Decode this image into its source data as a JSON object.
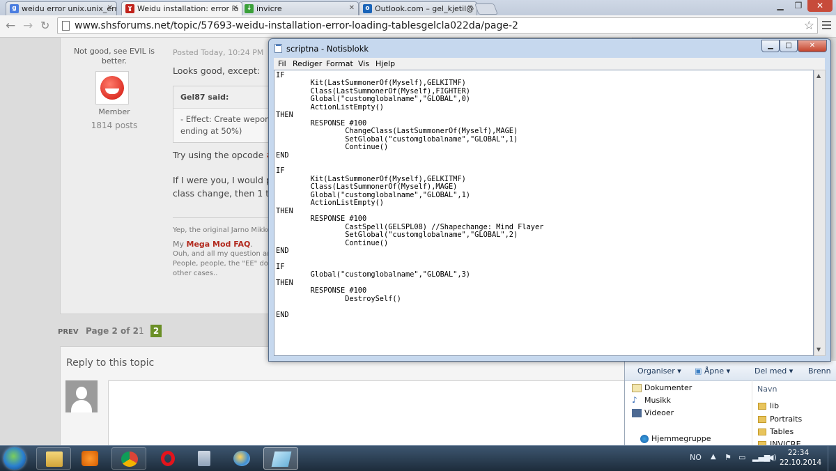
{
  "browser": {
    "tabs": [
      {
        "title": "weidu error unix.unix_erro",
        "icon": "google-icon",
        "color": "#4a7de0",
        "active": false
      },
      {
        "title": "Weidu installation: error lo",
        "icon": "shs-devil-icon",
        "color": "#c0231c",
        "active": true
      },
      {
        "title": "invicre",
        "icon": "download-icon",
        "color": "#3aa03a",
        "active": false
      },
      {
        "title": "Outlook.com – gel_kjetil@",
        "icon": "outlook-icon",
        "color": "#1a64b8",
        "active": false
      }
    ],
    "url": "www.shsforums.net/topic/57693-weidu-installation-error-loading-tablesgelcla022da/page-2"
  },
  "post": {
    "user_rank": "Not good, see EVIL is better.",
    "member_group": "Member",
    "post_count": "1814 posts",
    "posted": "Posted Today, 10:24 PM",
    "line1": "Looks good, except:",
    "quote_author": "Gel87 said:",
    "quote_line1": "- Effect: Create wepon(",
    "quote_line2": "ending at 50%)",
    "try_prefix": "Try using the opcode ",
    "try_opcode": "#",
    "line3a": "If I were you, I would pl",
    "line3b": "class change, then 1 to",
    "sig_line1": "Yep, the original Jarno Mikko",
    "sig_my": "My ",
    "sig_link": "Mega Mod FAQ",
    "sig_dot": ".",
    "sig_line3": "Ouh, and all my question ans",
    "sig_line4": "People, people, the \"EE\" does",
    "sig_line5": "other cases.."
  },
  "pagination": {
    "prev": "PREV",
    "label": "Page 2 of 2",
    "page1": "1",
    "page2": "2"
  },
  "reply": {
    "title": "Reply to this topic"
  },
  "notepad": {
    "title": "scriptna - Notisblokk",
    "menu": [
      "Fil",
      "Rediger",
      "Format",
      "Vis",
      "Hjelp"
    ],
    "code": "IF\n\tKit(LastSummonerOf(Myself),GELKITMF)\n\tClass(LastSummonerOf(Myself),FIGHTER)\n\tGlobal(\"customglobalname\",\"GLOBAL\",0)\n\tActionListEmpty()\nTHEN\n\tRESPONSE #100\n\t\tChangeClass(LastSummonerOf(Myself),MAGE)\n\t\tSetGlobal(\"customglobalname\",\"GLOBAL\",1)\n\t\tContinue()\nEND\n\nIF\n\tKit(LastSummonerOf(Myself),GELKITMF)\n\tClass(LastSummonerOf(Myself),MAGE)\n\tGlobal(\"customglobalname\",\"GLOBAL\",1)\n\tActionListEmpty()\nTHEN\n\tRESPONSE #100\n\t\tCastSpell(GELSPL08) //Shapechange: Mind Flayer\n\t\tSetGlobal(\"customglobalname\",\"GLOBAL\",2)\n\t\tContinue()\nEND\n\nIF\n\tGlobal(\"customglobalname\",\"GLOBAL\",3)\nTHEN\n\tRESPONSE #100\n\t\tDestroySelf()\n\nEND"
  },
  "explorer": {
    "commands": [
      "Organiser",
      "Åpne",
      "Del med",
      "Brenn"
    ],
    "nav": [
      "Dokumenter",
      "Musikk",
      "Videoer",
      "Hjemmegruppe"
    ],
    "column": "Navn",
    "files": [
      "lib",
      "Portraits",
      "Tables",
      "INVICRE"
    ]
  },
  "taskbar": {
    "lang": "NO",
    "time": "22:34",
    "date": "22.10.2014",
    "apps": [
      "explorer-icon",
      "media-player-icon",
      "chrome-icon",
      "opera-icon",
      "calculator-icon",
      "paint-icon",
      "notepad-icon"
    ]
  }
}
